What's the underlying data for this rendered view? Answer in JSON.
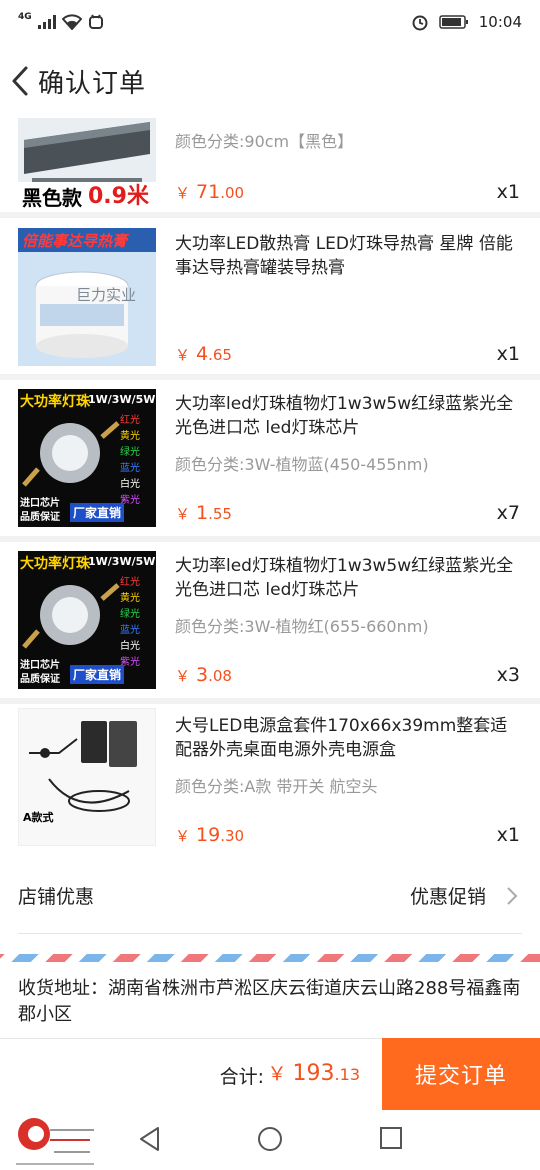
{
  "status": {
    "network": "4G",
    "time": "10:04"
  },
  "header": {
    "title": "确认订单",
    "back_icon": "chevron-left-icon"
  },
  "items": [
    {
      "thumb_text": "黑色款",
      "thumb_badge": "0.9米",
      "variant": "颜色分类:90cm【黑色】",
      "price_int": "71",
      "price_dec": ".00",
      "qty": "x1"
    },
    {
      "thumb_text": "倍能事达导热膏",
      "thumb_watermark": "巨力实业",
      "title": "大功率LED散热膏 LED灯珠导热膏 星牌 倍能事达导热膏罐装导热膏",
      "price_int": "4",
      "price_dec": ".65",
      "qty": "x1"
    },
    {
      "thumb_text": "大功率灯珠",
      "thumb_spec": "1W/3W/5W",
      "thumb_colors": [
        "红光",
        "黄光",
        "绿光",
        "蓝光",
        "白光",
        "紫光"
      ],
      "thumb_bottom_left": "进口芯片 品质保证",
      "thumb_bottom_mid": "厂家直销",
      "title": "大功率led灯珠植物灯1w3w5w红绿蓝紫光全光色进口芯 led灯珠芯片",
      "variant": "颜色分类:3W-植物蓝(450-455nm)",
      "price_int": "1",
      "price_dec": ".55",
      "qty": "x7"
    },
    {
      "thumb_text": "大功率灯珠",
      "thumb_spec": "1W/3W/5W",
      "thumb_colors": [
        "红光",
        "黄光",
        "绿光",
        "蓝光",
        "白光",
        "紫光"
      ],
      "thumb_bottom_left": "进口芯片 品质保证",
      "thumb_bottom_mid": "厂家直销",
      "title": "大功率led灯珠植物灯1w3w5w红绿蓝紫光全光色进口芯 led灯珠芯片",
      "variant": "颜色分类:3W-植物红(655-660nm)",
      "price_int": "3",
      "price_dec": ".08",
      "qty": "x3"
    },
    {
      "thumb_text": "A款式",
      "title": "大号LED电源盒套件170x66x39mm整套适配器外壳桌面电源外壳电源盒",
      "variant": "颜色分类:A款 带开关 航空头",
      "price_int": "19",
      "price_dec": ".30",
      "qty": "x1"
    }
  ],
  "currency": "￥",
  "store": {
    "label": "店铺优惠",
    "value": "优惠促销"
  },
  "address": {
    "text": "收货地址：湖南省株洲市芦淞区庆云街道庆云山路288号福鑫南郡小区"
  },
  "bottom": {
    "total_label": "合计:",
    "total_int": "193",
    "total_dec": ".13",
    "submit_label": "提交订单"
  },
  "colors": {
    "accent": "#ff6a1f",
    "price": "#f4511e"
  }
}
